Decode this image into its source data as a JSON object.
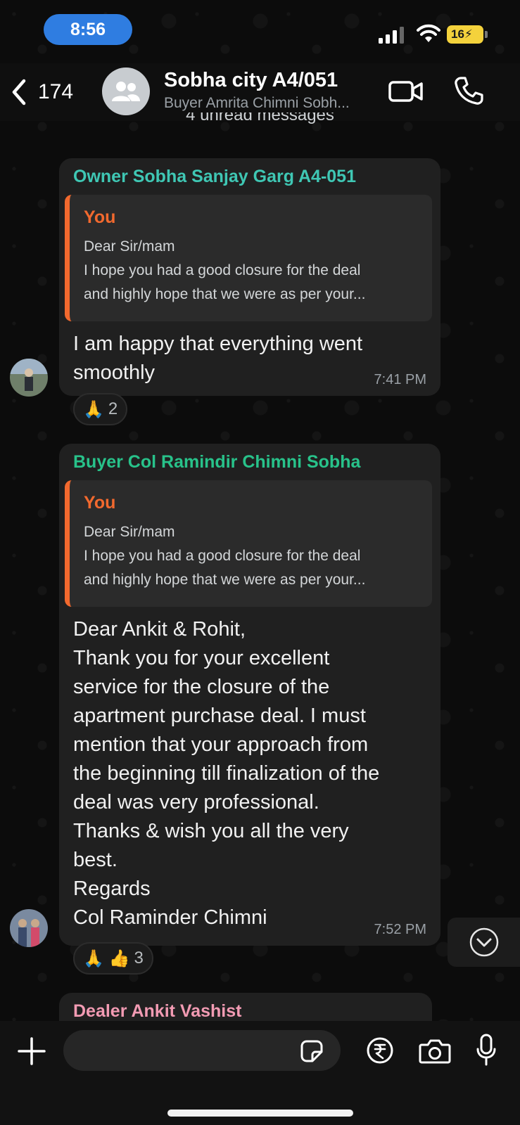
{
  "status_bar": {
    "time": "8:56",
    "battery": "16"
  },
  "header": {
    "back_count": "174",
    "title": "Sobha city A4/051",
    "subtitle": "Buyer Amrita Chimni Sobh..."
  },
  "unread_banner": "4 unread messages",
  "messages": [
    {
      "sender": "Owner Sobha Sanjay Garg A4-051",
      "sender_color": "#3fc7b4",
      "quote": {
        "author": "You",
        "lines": [
          "Dear Sir/mam",
          "I hope you had a good closure for the deal",
          "and highly hope that we were as per your..."
        ]
      },
      "text": "I am happy that everything went\nsmoothly",
      "time": "7:41 PM",
      "reaction": {
        "emojis": "🙏",
        "count": "2"
      }
    },
    {
      "sender": "Buyer Col Ramindir Chimni Sobha",
      "sender_color": "#28c28a",
      "quote": {
        "author": "You",
        "lines": [
          "Dear Sir/mam",
          "I hope you had a good closure for the deal",
          "and highly hope that we were as per your..."
        ]
      },
      "text": "Dear Ankit & Rohit,\nThank you for your excellent\nservice for the closure of the\napartment purchase deal. I must\nmention that your approach from\nthe beginning till finalization of the\ndeal was very professional.\nThanks & wish you all the very\nbest.\nRegards\nCol Raminder Chimni",
      "time": "7:52 PM",
      "reaction": {
        "emojis": "🙏 👍",
        "count": "3"
      }
    },
    {
      "sender": "Dealer Ankit Vashist",
      "sender_color": "#f29bb3"
    }
  ],
  "icons": {
    "back": "chevron-left-icon",
    "group_avatar": "group-icon",
    "video": "video-camera-icon",
    "call": "phone-icon",
    "scroll_down": "chevron-down-icon",
    "plus": "plus-icon",
    "sticker": "sticker-icon",
    "rupee": "rupee-icon",
    "camera": "camera-icon",
    "mic": "microphone-icon"
  }
}
